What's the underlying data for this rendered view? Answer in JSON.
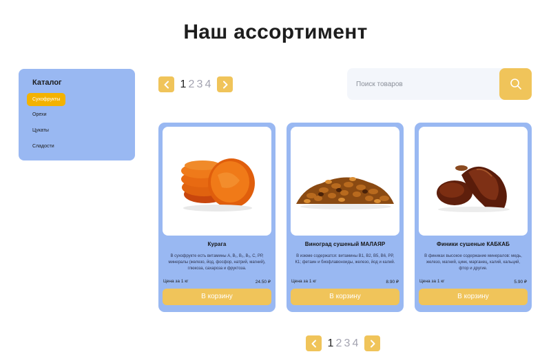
{
  "page_title": "Наш ассортимент",
  "sidebar": {
    "title": "Каталог",
    "items": [
      {
        "label": "Сухофрукты",
        "active": true
      },
      {
        "label": "Орехи",
        "active": false
      },
      {
        "label": "Цукаты",
        "active": false
      },
      {
        "label": "Сладости",
        "active": false
      }
    ]
  },
  "pagination": {
    "pages": [
      "1",
      "2",
      "3",
      "4"
    ],
    "current": "1",
    "prev_icon": "chevron-left-icon",
    "next_icon": "chevron-right-icon"
  },
  "search": {
    "placeholder": "Поиск товаров",
    "value": "",
    "icon": "search-icon"
  },
  "products": [
    {
      "name": "Курага",
      "description": "В сухофрукте есть витамины А, В₁, В₂, В₅, С, РР, минералы (железо, йод, фосфор, натрий, магний), глюкоза, сахароза и фруктоза.",
      "price_label": "Цена за 1 кг",
      "price": "24.50 ₽",
      "button": "В корзину",
      "image": "dried-apricots-image"
    },
    {
      "name": "Виноград сушеный МАЛАЯР",
      "description": "В изюме содержатся: витамины В1, В2, В5, В6, РР, К1; фетаин и биофлавоноиды, железо, йод и калий.",
      "price_label": "Цена за 1 кг",
      "price": "8.90 ₽",
      "button": "В корзину",
      "image": "raisins-image"
    },
    {
      "name": "Финики сушеные КАБКАБ",
      "description": "В финиках высокое содержание минералов: медь, железо, магний, цинк, марганец, калий, кальций, фтор и другие.",
      "price_label": "Цена за 1 кг",
      "price": "5.90 ₽",
      "button": "В корзину",
      "image": "dates-image"
    }
  ],
  "colors": {
    "accent": "#f0c45a",
    "active_category": "#f3b200",
    "panel": "#99b8f2"
  }
}
